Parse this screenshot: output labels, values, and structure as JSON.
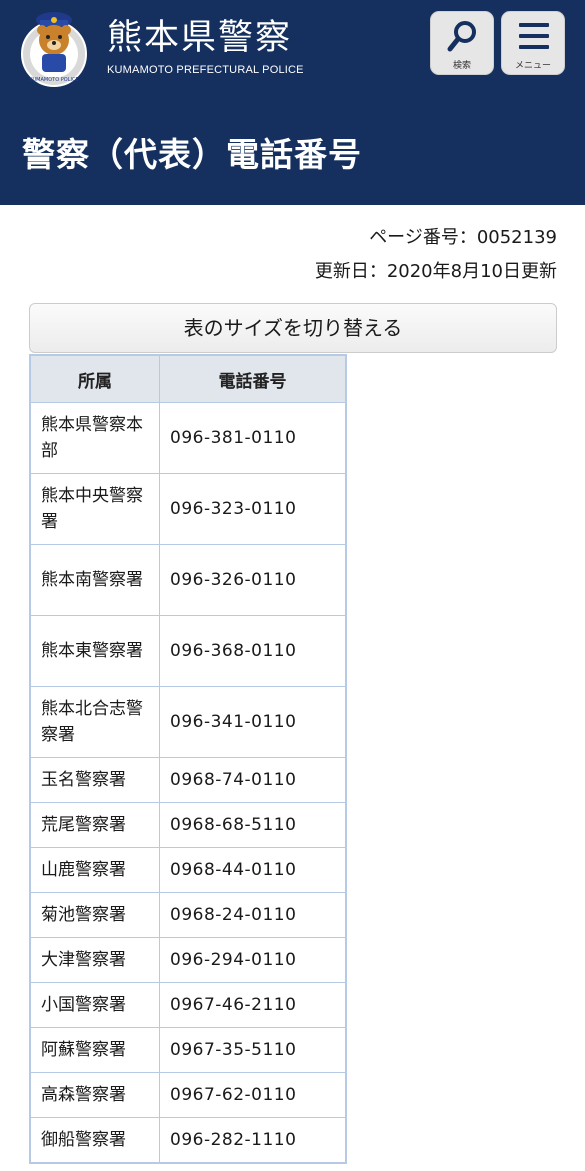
{
  "header": {
    "site_title": "熊本県警察",
    "site_subtitle": "KUMAMOTO PREFECTURAL POLICE",
    "logo_text": "KUMAMOTO POLICE",
    "search_label": "検索",
    "menu_label": "メニュー"
  },
  "page": {
    "title": "警察（代表）電話番号",
    "page_number": "ページ番号：0052139",
    "update_date": "更新日：2020年8月10日更新",
    "toggle_button": "表のサイズを切り替える"
  },
  "table": {
    "headers": [
      "所属",
      "電話番号"
    ],
    "rows": [
      {
        "name": "熊本県警察本部",
        "tel": "096-381-0110"
      },
      {
        "name": "熊本中央警察署",
        "tel": "096-323-0110"
      },
      {
        "name": "熊本南警察署",
        "tel": "096-326-0110"
      },
      {
        "name": "熊本東警察署",
        "tel": "096-368-0110"
      },
      {
        "name": "熊本北合志警察署",
        "tel": "096-341-0110"
      },
      {
        "name": "玉名警察署",
        "tel": "0968-74-0110"
      },
      {
        "name": "荒尾警察署",
        "tel": "0968-68-5110"
      },
      {
        "name": "山鹿警察署",
        "tel": "0968-44-0110"
      },
      {
        "name": "菊池警察署",
        "tel": "0968-24-0110"
      },
      {
        "name": "大津警察署",
        "tel": "096-294-0110"
      },
      {
        "name": "小国警察署",
        "tel": "0967-46-2110"
      },
      {
        "name": "阿蘇警察署",
        "tel": "0967-35-5110"
      },
      {
        "name": "高森警察署",
        "tel": "0967-62-0110"
      },
      {
        "name": "御船警察署",
        "tel": "096-282-1110"
      }
    ]
  },
  "colors": {
    "header_bg": "#15305f",
    "table_border": "#b7cae5",
    "table_header_bg": "#e1e6ec"
  },
  "icons": [
    "police-mascot-logo",
    "search-icon",
    "menu-icon"
  ]
}
